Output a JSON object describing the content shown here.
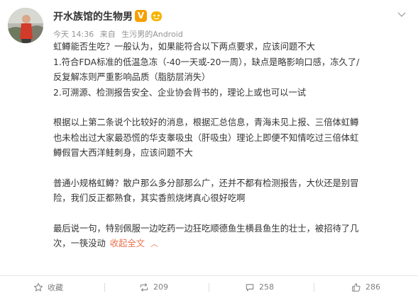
{
  "post": {
    "username": "开水族馆的生物男",
    "verified_badge": "V",
    "meta": {
      "date": "今天 14:36",
      "source_prefix": "来自",
      "source": "生污男的Android"
    },
    "paragraphs": [
      [
        "虹鳟能否生吃？一般认为，如果能符合以下两点要求，应该问题不大",
        "1.符合FDA标准的低温急冻（-40一天或-20一周），缺点是略影响口感，冻久了/",
        "反复解冻则严重影响品质（脂肪层消失）",
        "2.可溯源、检测报告安全、企业协会背书的，理论上或也可以一试"
      ],
      [
        "根据以上第二条说个比较好的消息，根据汇总信息，青海未见上报、三倍体虹鳟",
        "也未检出过大家最恐慌的华支睾吸虫（肝吸虫）理论上即便不知情吃过三倍体虹",
        "鳟假冒大西洋鲑刺身，应该问题不大"
      ],
      [
        "普通小规格虹鳟？散户那么多分部那么广，还并不都有检测报告，大伙还是别冒",
        "险，我们反正都熟食，其实香煎烧烤真心很好吃啊"
      ],
      [
        "最后说一句，特别佩服一边吃药一边狂吃顺德鱼生横县鱼生的壮士，被招待了几",
        "次，一筷没动"
      ]
    ],
    "collapse_label": "收起全文",
    "collapse_arrow": "︿"
  },
  "actions": {
    "favorite": {
      "label": "收藏",
      "icon": "star-icon"
    },
    "repost": {
      "count": "209",
      "icon": "repost-icon"
    },
    "comment": {
      "count": "258",
      "icon": "comment-icon"
    },
    "like": {
      "count": "286",
      "icon": "thumbs-up-icon"
    }
  },
  "colors": {
    "link": "#eb7350",
    "badge": "#f4a100",
    "meta_text": "#939393",
    "action_text": "#808080"
  }
}
